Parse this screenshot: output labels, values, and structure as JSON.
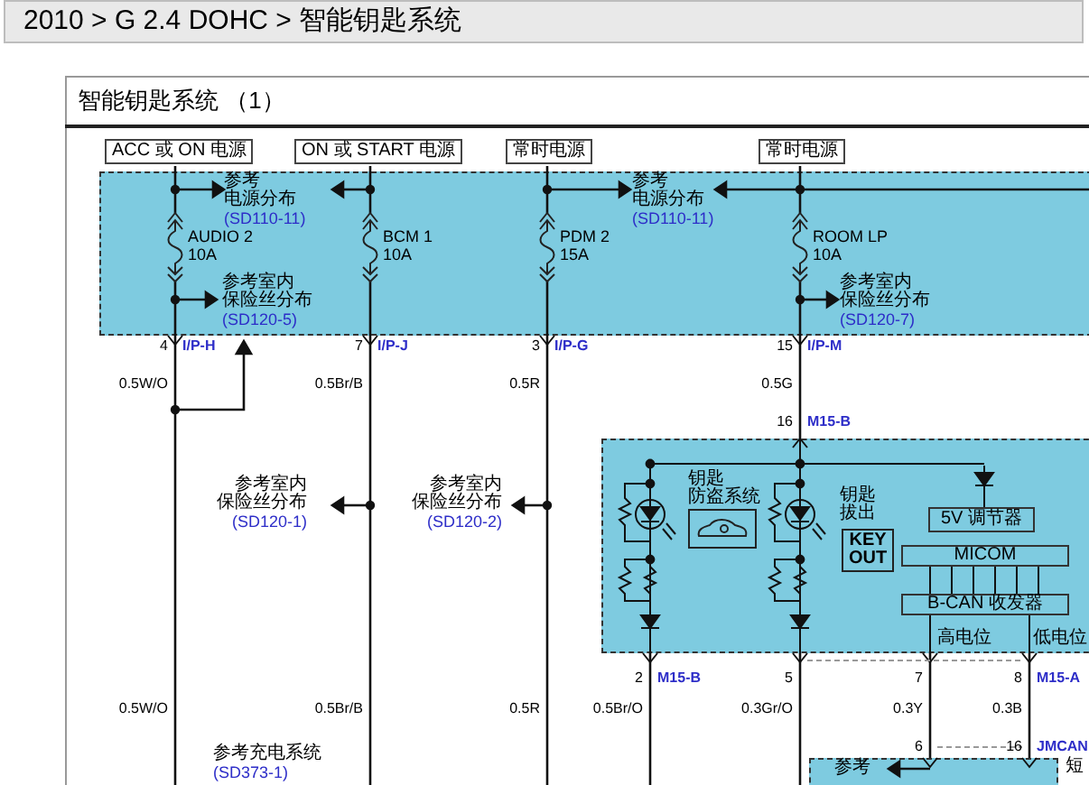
{
  "breadcrumb": "2010 > G 2.4 DOHC > 智能钥匙系统",
  "title": "智能钥匙系统 （1）",
  "power_sources": [
    "ACC 或 ON 电源",
    "ON 或 START 电源",
    "常时电源",
    "常时电源"
  ],
  "fuses": [
    {
      "name": "AUDIO 2",
      "rating": "10A"
    },
    {
      "name": "BCM 1",
      "rating": "10A"
    },
    {
      "name": "PDM 2",
      "rating": "15A"
    },
    {
      "name": "ROOM LP",
      "rating": "10A"
    }
  ],
  "fuse_box_notes": [
    {
      "lines": [
        "参考",
        "电源分布"
      ],
      "code": "(SD110-11)"
    },
    {
      "lines": [
        "参考室内",
        "保险丝分布"
      ],
      "code": "(SD120-5)"
    },
    {
      "lines": [
        "参考",
        "电源分布"
      ],
      "code": "(SD110-11)"
    },
    {
      "lines": [
        "参考室内",
        "保险丝分布"
      ],
      "code": "(SD120-7)"
    }
  ],
  "connectors": [
    {
      "pin": "4",
      "name": "I/P-H"
    },
    {
      "pin": "7",
      "name": "I/P-J"
    },
    {
      "pin": "3",
      "name": "I/P-G"
    },
    {
      "pin": "15",
      "name": "I/P-M"
    },
    {
      "pin": "16",
      "name": "M15-B"
    },
    {
      "pin": "2",
      "name": "M15-B"
    },
    {
      "pin": "5"
    },
    {
      "pin": "7"
    },
    {
      "pin": "8",
      "name": "M15-A"
    },
    {
      "pin": "6"
    },
    {
      "pin": "16",
      "name": "JMCAN"
    }
  ],
  "wires": [
    "0.5W/O",
    "0.5Br/B",
    "0.5R",
    "0.5G",
    "0.5W/O",
    "0.5Br/B",
    "0.5R",
    "0.5Br/O",
    "0.3Gr/O",
    "0.3Y",
    "0.3B"
  ],
  "notes": [
    {
      "lines": [
        "参考室内",
        "保险丝分布"
      ],
      "code": "(SD120-1)"
    },
    {
      "lines": [
        "参考室内",
        "保险丝分布"
      ],
      "code": "(SD120-2)"
    },
    {
      "lines": [
        "参考充电系统"
      ],
      "code": "(SD373-1)"
    }
  ],
  "module": {
    "immobilizer_label": [
      "钥匙",
      "防盗系统"
    ],
    "key_out_label": [
      "钥匙",
      "拔出"
    ],
    "key_out_badge": [
      "KEY",
      "OUT"
    ],
    "blocks": [
      "5V 调节器",
      "MICOM",
      "B-CAN 收发器"
    ],
    "outputs": [
      "高电位",
      "低电位"
    ]
  },
  "bottom_panel": {
    "note": "参考",
    "side_text": "短"
  }
}
